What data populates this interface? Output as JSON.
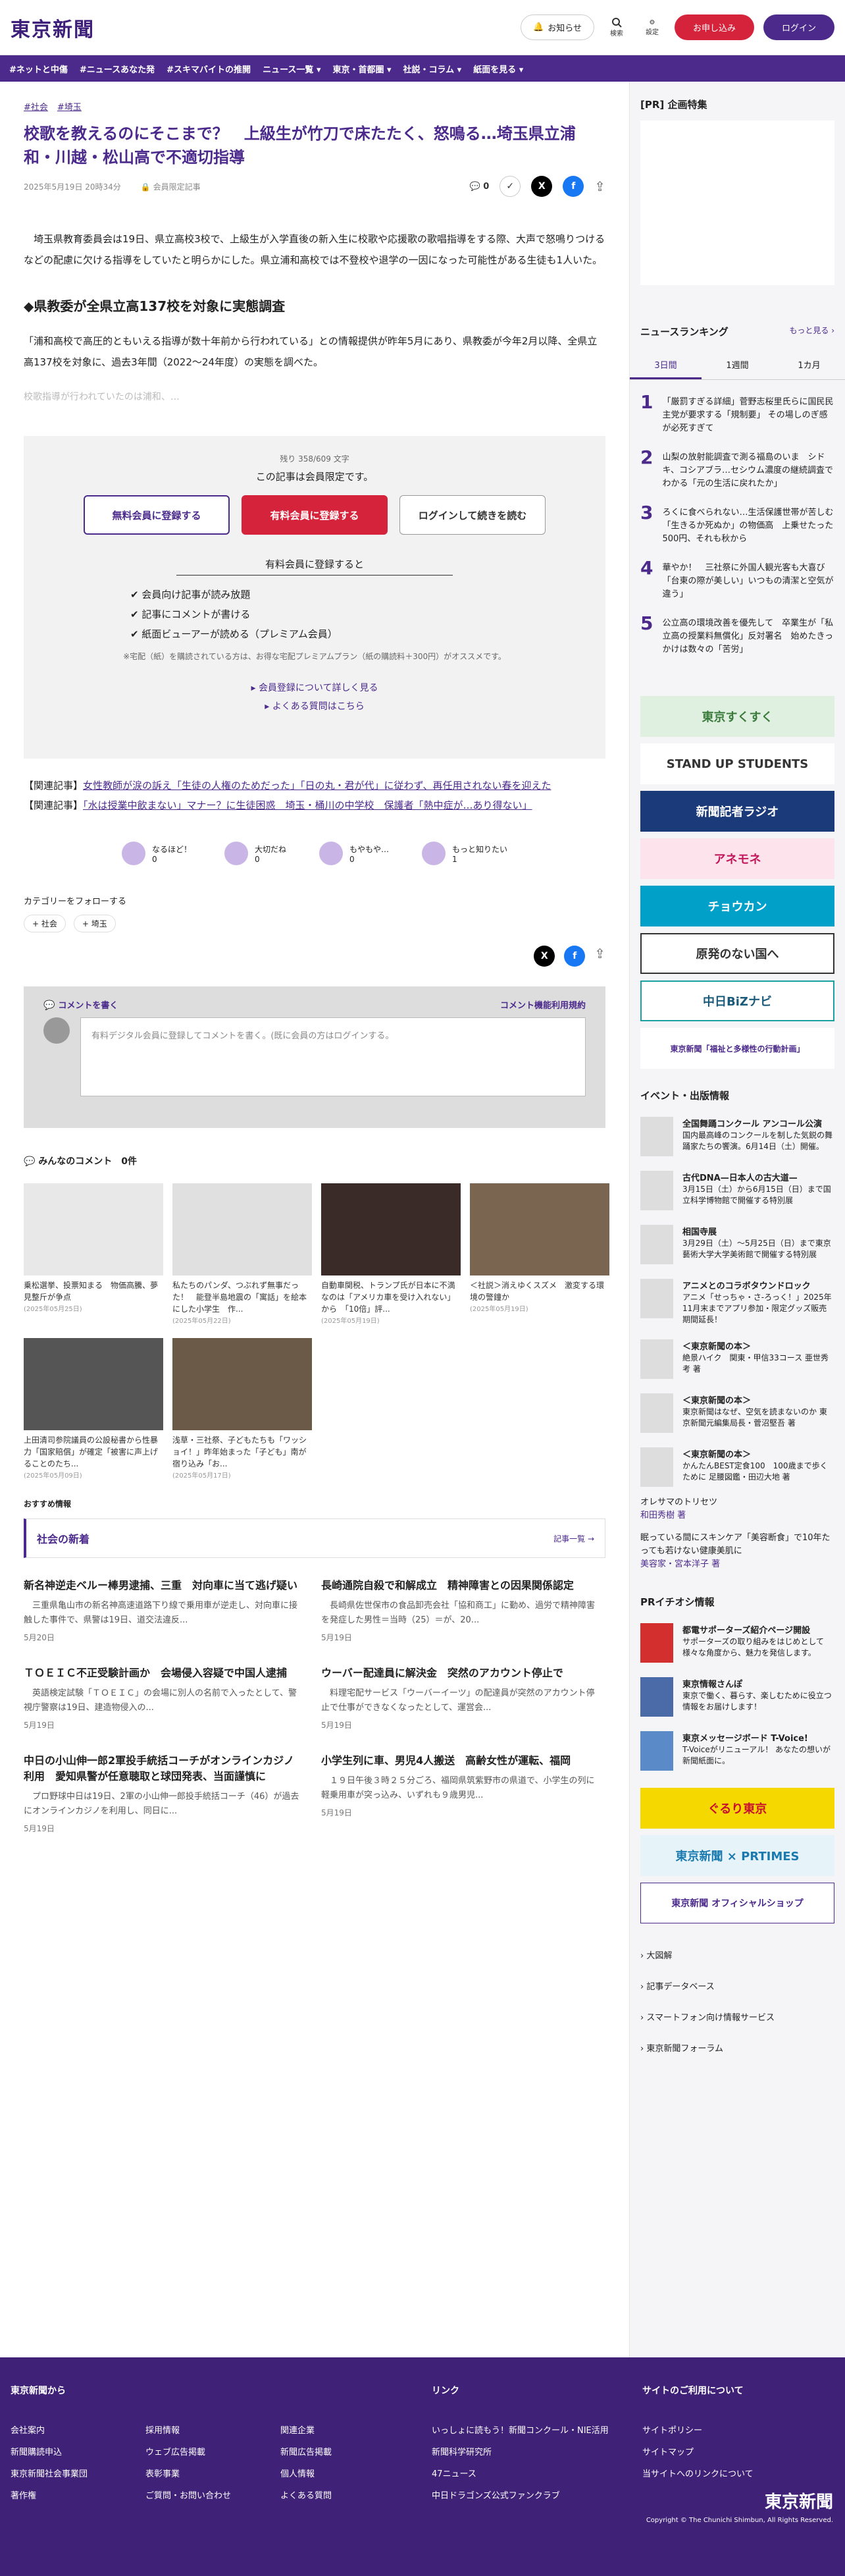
{
  "header": {
    "logo": "東京新聞",
    "notify": "お知らせ",
    "search": "検索",
    "settings": "設定",
    "apply": "お申し込み",
    "login": "ログイン"
  },
  "nav": [
    "#ネットと中傷",
    "#ニュースあなた発",
    "#スキマバイトの推開",
    "ニュース一覧 ▾",
    "東京・首都圏 ▾",
    "社説・コラム ▾",
    "紙面を見る ▾"
  ],
  "article": {
    "tags": [
      "#社会",
      "#埼玉"
    ],
    "title": "校歌を教えるのにそこまで？　上級生が竹刀で床たたく、怒鳴る…埼玉県立浦和・川越・松山高で不適切指導",
    "date": "2025年5月19日 20時34分",
    "member": "会員限定記事",
    "comments": "0",
    "p1": "　埼玉県教育委員会は19日、県立高校3校で、上級生が入学直後の新入生に校歌や応援歌の歌唱指導をする際、大声で怒鳴りつけるなどの配慮に欠ける指導をしていたと明らかにした。県立浦和高校では不登校や退学の一因になった可能性がある生徒も1人いた。",
    "h2": "◆県教委が全県立高137校を対象に実態調査",
    "p2": "「浦和高校で高圧的ともいえる指導が数十年前から行われている」との情報提供が昨年5月にあり、県教委が今年2月以降、全県立高137校を対象に、過去3年間（2022〜24年度）の実態を調べた。",
    "fade": "校歌指導が行われていたのは浦和、…"
  },
  "paywall": {
    "remain": "残り 358/609 文字",
    "lead": "この記事は会員限定です。",
    "free": "無料会員に登録する",
    "paid": "有料会員に登録する",
    "login": "ログインして続きを読む",
    "bh": "有料会員に登録すると",
    "benefits": [
      "会員向け記事が読み放題",
      "記事にコメントが書ける",
      "紙面ビューアーが読める（プレミアム会員）"
    ],
    "note": "※宅配（紙）を購読されている方は、お得な宅配プレミアムプラン（紙の購読料＋300円）がオススメです。",
    "more": "会員登録について詳しく見る",
    "faq": "よくある質問はこちら"
  },
  "related": [
    {
      "k": "【関連記事】",
      "t": "女性教師が涙の訴え「生徒の人権のためだった」「日の丸・君が代」に従わず、再任用されない春を迎えた"
    },
    {
      "k": "【関連記事】",
      "t": "「水は授業中飲まない」マナー？に生徒困惑　埼玉・桶川の中学校　保護者「熱中症が…あり得ない」"
    }
  ],
  "reactions": [
    {
      "l": "なるほど！",
      "c": "0"
    },
    {
      "l": "大切だね",
      "c": "0"
    },
    {
      "l": "もやもや…",
      "c": "0"
    },
    {
      "l": "もっと知りたい",
      "c": "1"
    }
  ],
  "follow": {
    "label": "カテゴリーをフォローする",
    "chips": [
      "+ 社会",
      "+ 埼玉"
    ]
  },
  "comment": {
    "head": "コメントを書く",
    "rule": "コメント機能利用規約",
    "ph": "有料デジタル会員に登録してコメントを書く。(既に会員の方はログインする。"
  },
  "allc": "みんなのコメント　0件",
  "cards": [
    {
      "t": "乗松選挙、投票知まる　物価高騰、夢見整斤が争点",
      "d": "(2025年05月25日)"
    },
    {
      "t": "私たちのパンダ、つぶれず無事だった！　能登半島地震の「寓話」を絵本にした小学生　作...",
      "d": "(2025年05月22日)"
    },
    {
      "t": "自動車関税、トランプ氏が日本に不満なのは「アメリカ車を受け入れない」から　「10倍」評...",
      "d": "(2025年05月19日)"
    },
    {
      "t": "＜社説＞消えゆくスズメ　激変する環境の警鐘か",
      "d": "(2025年05月19日)"
    },
    {
      "t": "上田清司参院議員の公設秘書から性暴力「国家賠償」が確定「被害に声上げることのたち...",
      "d": "(2025年05月09日)"
    },
    {
      "t": "浅草・三社祭、子どもたちも「ワッショイ！」昨年始まった「子ども」南が宿り込み「お...",
      "d": "(2025年05月17日)"
    }
  ],
  "rec": "おすすめ情報",
  "society": {
    "title": "社会の新着",
    "more": "記事一覧 →",
    "items": [
      {
        "t": "新名神逆走ベルー棒男逮捕、三重　対向車に当て逃げ疑い",
        "s": "　三重県亀山市の新名神高速道路下り線で乗用車が逆走し、対向車に接触した事件で、県警は19日、道交法違反...",
        "d": "5月20日"
      },
      {
        "t": "長崎通院自殺で和解成立　精神障害との因果関係認定",
        "s": "　長崎県佐世保市の食品卸売会社「協和商工」に勤め、過労で精神障害を発症した男性＝当時（25）＝が、20...",
        "d": "5月19日"
      },
      {
        "t": "ＴＯＥＩＣ不正受験計画か　会場侵入容疑で中国人逮捕",
        "s": "　英語検定試験「ＴＯＥＩＣ」の会場に別人の名前で入ったとして、警視庁警察は19日、建造物侵入の...",
        "d": "5月19日"
      },
      {
        "t": "ウーバー配達員に解決金　突然のアカウント停止で",
        "s": "　料理宅配サービス「ウーバーイーツ」の配達員が突然のアカウント停止で仕事ができなくなったとして、運営会...",
        "d": "5月19日"
      },
      {
        "t": "中日の小山伸一郎2軍投手統括コーチがオンラインカジノ利用　愛知県警が任意聴取と球団発表、当面謹慎に",
        "s": "　プロ野球中日は19日、2軍の小山伸一郎投手統括コーチ（46）が過去にオンラインカジノを利用し、同日に...",
        "d": "5月19日"
      },
      {
        "t": "小学生列に車、男児4人搬送　高齢女性が運転、福岡",
        "s": "　１９日午後３時２５分ごろ、福岡県筑紫野市の県道で、小学生の列に軽乗用車が突っ込み、いずれも９歳男児...",
        "d": "5月19日"
      }
    ]
  },
  "side": {
    "pr": "[PR] 企画特集",
    "rk": "ニュースランキング",
    "rkmore": "もっと見る ›",
    "tabs": [
      "3日間",
      "1週間",
      "1カ月"
    ],
    "rank": [
      {
        "n": "1",
        "t": "「厳罰すぎる詳細」菅野志桜里氏らに国民民主党が要求する「規制要」 その場しのぎ感が必死すぎて"
      },
      {
        "n": "2",
        "t": "山梨の放射能調査で測る福島のいま　シドキ、コシアブラ…セシウム濃度の継続調査でわかる「元の生活に戻れたか」"
      },
      {
        "n": "3",
        "t": "ろくに食べられない…生活保護世帯が苦しむ「生きるか死ぬか」の物価高　上乗せたった500円、それも秋から"
      },
      {
        "n": "4",
        "t": "華やか！　三社祭に外国人観光客も大喜び「台東の際が美しい」いつもの清潔と空気が違う」"
      },
      {
        "n": "5",
        "t": "公立高の環境改善を優先して　卒業生が「私立高の授業料無償化」反対署名　始めたきっかけは数々の「苦労」"
      }
    ],
    "banners": [
      "東京すくすく",
      "STAND UP STUDENTS",
      "新聞記者ラジオ",
      "アネモネ",
      "チョウカン",
      "原発のない国へ",
      "中日BiZナビ",
      "東京新聞「福祉と多様性の行動計画」"
    ],
    "ev": "イベント・出版情報",
    "events": [
      {
        "b": "全国舞踊コンクール アンコール公演",
        "s": "国内最高峰のコンクールを制した気鋭の舞踊家たちの饗演。6月14日（土）開催。"
      },
      {
        "b": "古代DNA—日本人の古大道—",
        "s": "3月15日（土）から6月15日（日）まで国立科学博物館で開催する特別展"
      },
      {
        "b": "相国寺展",
        "s": "3月29日（土）〜5月25日（日）まで東京藝術大学大学美術館で開催する特別展"
      },
      {
        "b": "アニメとのコラボタウンドロック",
        "s": "アニメ「せっちゃ・さ-ろっく！」2025年11月末までアプリ参加・限定グッズ販売期間延長！"
      },
      {
        "b": "＜東京新聞の本＞",
        "s": "絶景ハイク　関東・甲信33コース\n亜世秀考 著"
      },
      {
        "b": "＜東京新聞の本＞",
        "s": "東京新聞はなぜ、空気を読まないのか\n東京新聞元編集局長・菅沼堅吾 著"
      },
      {
        "b": "＜東京新聞の本＞",
        "s": "かんたんBEST定食100　100歳まで歩くために\n足腰図鑑・田辺大地 著"
      }
    ],
    "sl": [
      {
        "t": "オレサマのトリセツ",
        "s": "和田秀樹 著"
      },
      {
        "t": "眠っている間にスキンケア「美容断食」で10年たっても若けない健康美肌に",
        "s": "美容家・宮本洋子 著"
      }
    ],
    "pr2": "PRイチオシ情報",
    "pr2items": [
      {
        "b": "都電サポーターズ紹介ページ開設",
        "s": "サポーターズの取り組みをはじめとして様々な角度から、魅力を発信します。"
      },
      {
        "b": "東京情報さんぽ",
        "s": "東京で働く、暮らす、楽しむために役立つ情報をお届けします！"
      },
      {
        "b": "東京メッセージボード T-Voice!",
        "s": "T-Voiceがリニューアル！\nあなたの想いが新聞紙面に。"
      }
    ],
    "banners2": [
      "ぐるり東京",
      "東京新聞 × PRTIMES",
      "東京新聞 オフィシャルショップ"
    ],
    "links": [
      "大図解",
      "記事データベース",
      "スマートフォン向け情報サービス",
      "東京新聞フォーラム"
    ]
  },
  "footer": {
    "c1": "東京新聞から",
    "c2": "リンク",
    "c3": "サイトのご利用について",
    "a": [
      "会社案内",
      "新聞購読申込",
      "東京新聞社会事業団",
      "著作権"
    ],
    "b": [
      "採用情報",
      "ウェブ広告掲載",
      "表彰事業",
      "ご質問・お問い合わせ"
    ],
    "c": [
      "関連企業",
      "新聞広告掲載",
      "個人情報",
      "よくある質問"
    ],
    "d": [
      "いっしょに読もう！新聞コンクール・NIE活用",
      "新聞科学研究所",
      "47ニュース",
      "中日ドラゴンズ公式ファンクラブ"
    ],
    "e": [
      "サイトポリシー",
      "サイトマップ",
      "当サイトへのリンクについて"
    ],
    "logo": "東京新聞",
    "copy": "Copyright © The Chunichi Shimbun, All Rights Reserved."
  }
}
